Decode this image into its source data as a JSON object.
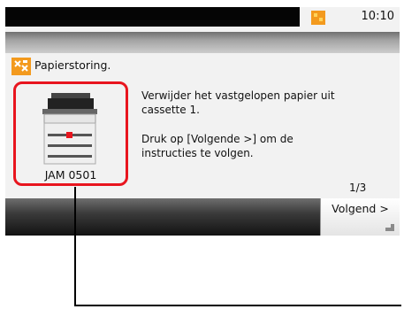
{
  "statusbar": {
    "time": "10:10",
    "notice_icon": "notice-icon"
  },
  "message": {
    "title": "Papierstoring.",
    "line1": "Verwijder het vastgelopen papier uit cassette 1.",
    "line2": "Druk op [Volgende >] om de instructies te volgen.",
    "jam_code": "JAM 0501",
    "page_indicator": "1/3"
  },
  "buttons": {
    "next_label": "Volgend >"
  },
  "icons": {
    "error": "paper-jam-icon",
    "printer": "printer-icon",
    "corner": "touch-corner-icon"
  },
  "colors": {
    "highlight_red": "#e8151e",
    "warning_orange": "#f39a1e",
    "status_black": "#050505"
  }
}
